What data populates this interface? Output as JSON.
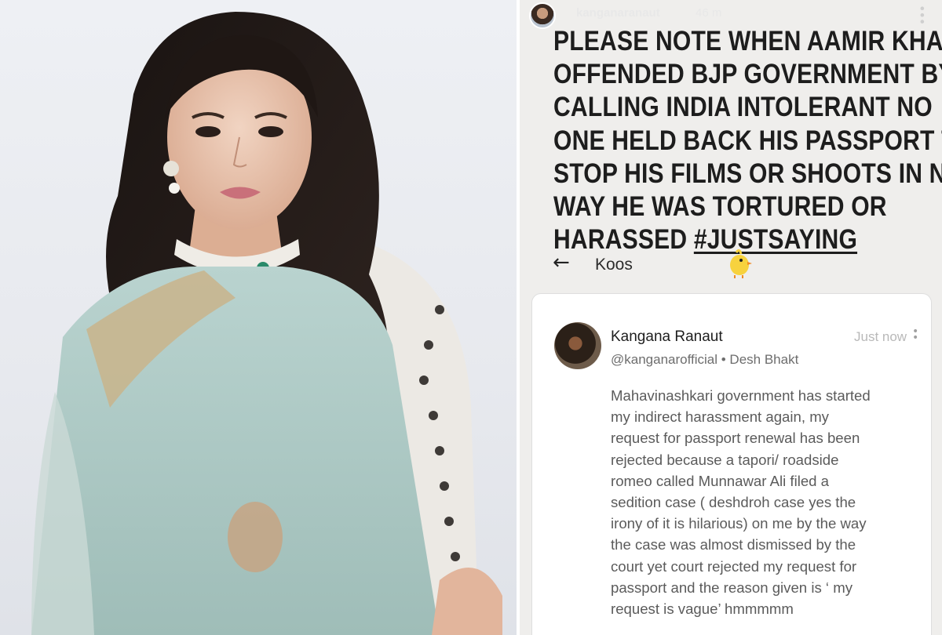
{
  "story": {
    "username": "kanganaranaut",
    "time": "46 m",
    "caption_lines": [
      "PLEASE NOTE WHEN AAMIR KHAN",
      "OFFENDED BJP GOVERNMENT BY",
      "CALLING INDIA INTOLERANT NO",
      "ONE HELD BACK HIS PASSPORT TO",
      "STOP HIS FILMS OR SHOOTS IN NO",
      "WAY HE WAS TORTURED OR"
    ],
    "caption_last_prefix": "HARASSED ",
    "hashtag": "#JUSTSAYING"
  },
  "koos": {
    "title": "Koos",
    "post": {
      "author_name": "Kangana Ranaut",
      "author_handle": "@kanganarofficial • Desh Bhakt",
      "time": "Just now",
      "body_lines": [
        "Mahavinashkari government has started",
        "my indirect harassment again, my",
        "request for passport renewal has been",
        "rejected because a tapori/ roadside",
        "romeo called Munnawar Ali filed a",
        "sedition case ( deshdroh case yes the",
        "irony of it is hilarious) on me by the way",
        "the case was almost dismissed by the",
        "court yet court rejected my request for",
        "passport and the reason given is ‘ my",
        "request is vague’ hmmmmm"
      ]
    }
  },
  "colors": {
    "koo_yellow": "#f7d23e",
    "caption_text": "#1d1d1d",
    "dress_mint": "#a9c7c2"
  }
}
